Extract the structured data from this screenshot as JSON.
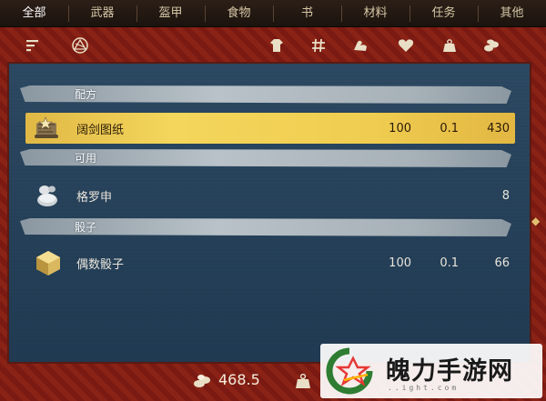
{
  "tabs": [
    "全部",
    "武器",
    "盔甲",
    "食物",
    "书",
    "材料",
    "任务",
    "其他"
  ],
  "active_tab_index": 0,
  "iconbar": {
    "icons": [
      "sort-icon",
      "alchemy-symbol-icon",
      "robe-icon",
      "hash-icon",
      "strength-arm-icon",
      "heart-icon",
      "weight-icon",
      "gold-coins-icon"
    ]
  },
  "sections": [
    {
      "label": "配方"
    },
    {
      "label": "可用"
    },
    {
      "label": "骰子"
    }
  ],
  "items": [
    {
      "name": "阔剑图纸",
      "v1": "100",
      "v2": "0.1",
      "v3": "430",
      "icon": "scroll-blueprint-icon",
      "selected": true
    },
    {
      "name": "格罗申",
      "v1": "",
      "v2": "",
      "v3": "8",
      "icon": "groschen-coins-icon",
      "selected": false
    },
    {
      "name": "偶数骰子",
      "v1": "100",
      "v2": "0.1",
      "v3": "66",
      "icon": "golden-die-icon",
      "selected": false
    }
  ],
  "bottom": {
    "money": "468.5",
    "money_icon": "coin-pile-icon",
    "weight_icon": "weight-icon"
  },
  "watermark": {
    "text": "魄力手游网",
    "sub": "..ight.com"
  },
  "colors": {
    "selected_row": "#f0cd50",
    "panel_bg": "#22405a",
    "frame_red": "#7a1a12"
  }
}
